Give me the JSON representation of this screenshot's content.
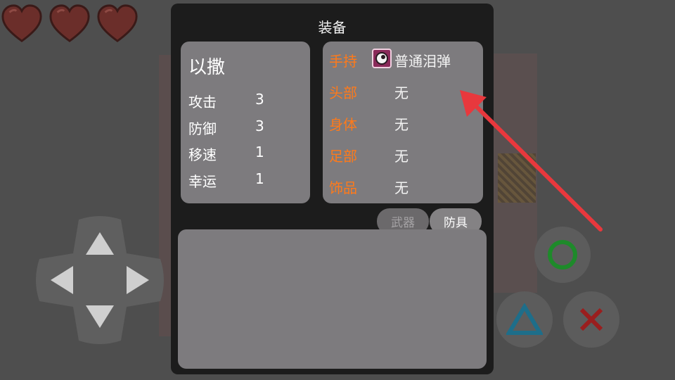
{
  "hud": {
    "hearts": 3,
    "heart_color": "#6b2e2a"
  },
  "panel": {
    "title": "装备",
    "character": {
      "name": "以撒",
      "stats": [
        {
          "label": "攻击",
          "value": "3"
        },
        {
          "label": "防御",
          "value": "3"
        },
        {
          "label": "移速",
          "value": "1"
        },
        {
          "label": "幸运",
          "value": "1"
        }
      ]
    },
    "slots": [
      {
        "label": "手持",
        "value": "普通泪弹",
        "icon": "tear-icon"
      },
      {
        "label": "头部",
        "value": "无"
      },
      {
        "label": "身体",
        "value": "无"
      },
      {
        "label": "足部",
        "value": "无"
      },
      {
        "label": "饰品",
        "value": "无"
      }
    ],
    "tabs": [
      {
        "label": "武器",
        "active": false
      },
      {
        "label": "防具",
        "active": true
      }
    ]
  },
  "controls": {
    "circle_color": "#1e8a2a",
    "triangle_color": "#1e6e8a",
    "cross_color": "#9a1e1e"
  },
  "colors": {
    "accent_label": "#ff7a1a",
    "card_bg": "#7d7b7e",
    "panel_bg": "#1c1c1c",
    "annotation_arrow": "#e8383d"
  }
}
